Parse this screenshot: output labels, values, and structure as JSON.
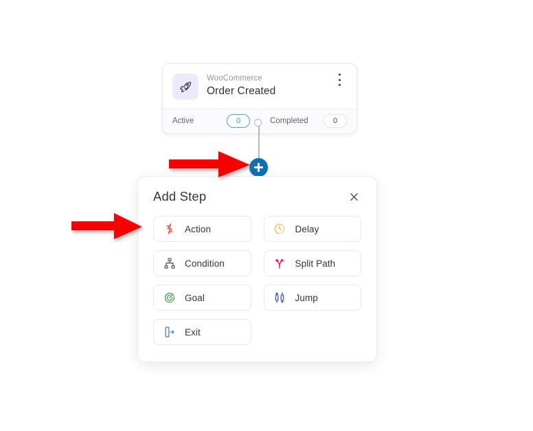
{
  "workflow": {
    "trigger_card": {
      "integration": "WooCommerce",
      "title": "Order Created",
      "icon": "rocket-icon",
      "icon_bg": "#eceafa",
      "menu_icon": "kebab-menu-icon",
      "stats": [
        {
          "label": "Active",
          "value": "0",
          "accent": "#37bda0"
        },
        {
          "label": "Completed",
          "value": "0",
          "accent": "#dfe2ea"
        }
      ]
    },
    "connector": {
      "node_icon": "connector-node-icon",
      "add_button_icon": "plus-icon",
      "add_button_color": "#0f6fb5"
    }
  },
  "add_step_panel": {
    "title": "Add Step",
    "close_icon": "close-icon",
    "options": [
      {
        "label": "Action",
        "icon": "lightning-bolt-icon",
        "color": "#f0502e"
      },
      {
        "label": "Delay",
        "icon": "clock-icon",
        "color": "#f5b638"
      },
      {
        "label": "Condition",
        "icon": "sitemap-icon",
        "color": "#56565f"
      },
      {
        "label": "Split Path",
        "icon": "split-path-icon",
        "color": "#ec1a5c"
      },
      {
        "label": "Goal",
        "icon": "target-icon",
        "color": "#3da54a"
      },
      {
        "label": "Jump",
        "icon": "jump-icon",
        "color": "#4155d6"
      },
      {
        "label": "Exit",
        "icon": "exit-door-icon",
        "color": "#3d80ef"
      }
    ]
  },
  "annotations": {
    "color": "#f90000",
    "arrows": [
      {
        "name": "arrow-pointing-to-add-step-button",
        "target": "add-step-plus-button"
      },
      {
        "name": "arrow-pointing-to-action-option",
        "target": "step-option-action"
      }
    ]
  }
}
